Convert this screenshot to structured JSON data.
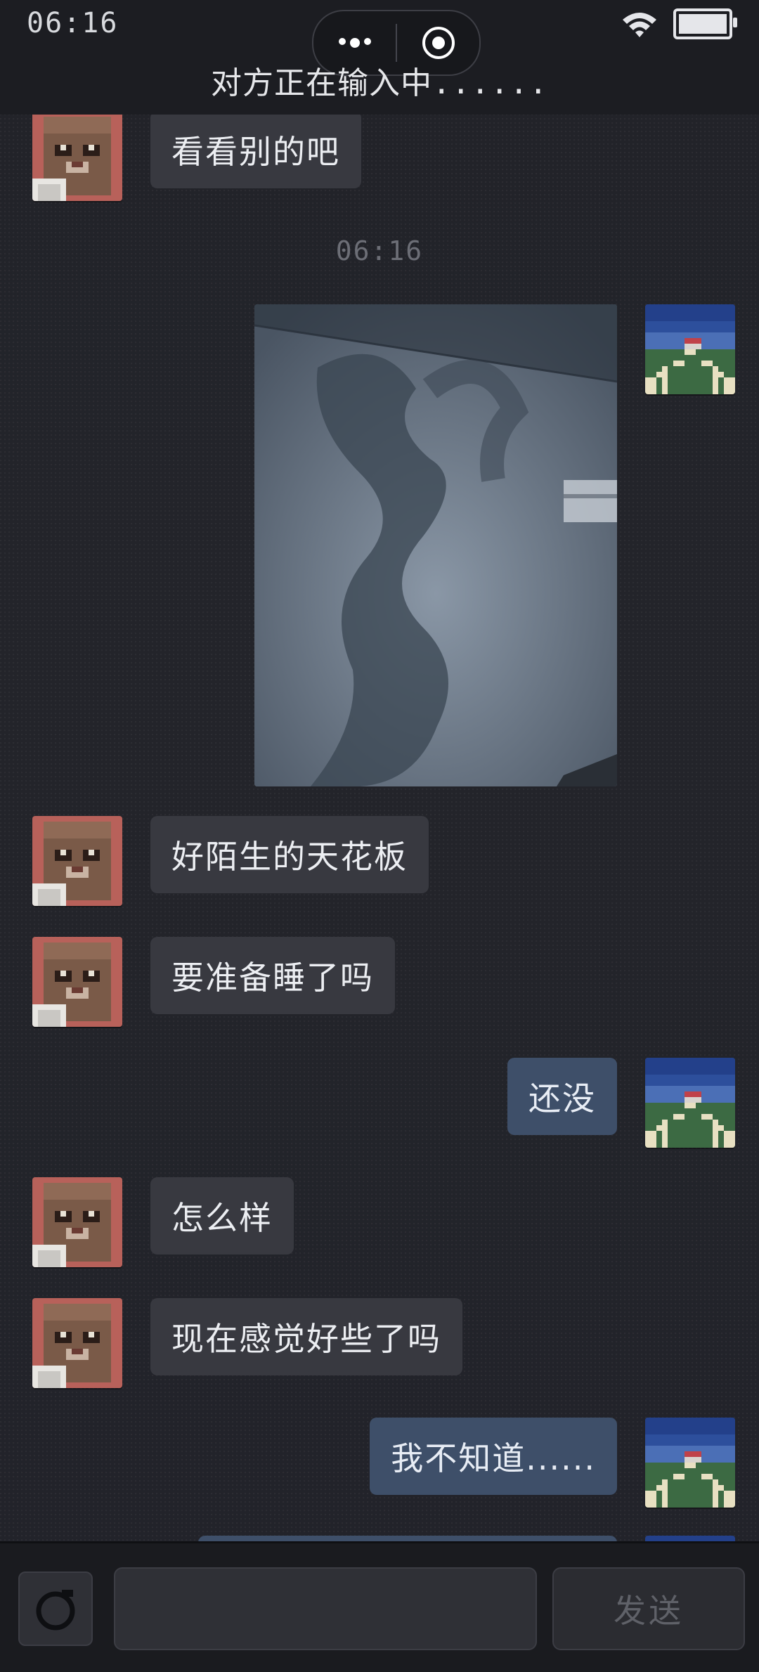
{
  "status_bar": {
    "time": "06:16"
  },
  "header": {
    "title": "对方正在输入中......",
    "capsule_more_icon": "more-dots-icon",
    "capsule_close_icon": "target-circle-icon"
  },
  "messages": [
    {
      "side": "in",
      "type": "text",
      "text": "看看别的吧"
    },
    {
      "type": "timestamp",
      "text": "06:16"
    },
    {
      "side": "out",
      "type": "image",
      "content": "ceiling-photo"
    },
    {
      "side": "in",
      "type": "text",
      "text": "好陌生的天花板"
    },
    {
      "side": "in",
      "type": "text",
      "text": "要准备睡了吗"
    },
    {
      "side": "out",
      "type": "text",
      "text": "还没"
    },
    {
      "side": "in",
      "type": "text",
      "text": "怎么样"
    },
    {
      "side": "in",
      "type": "text",
      "text": "现在感觉好些了吗"
    },
    {
      "side": "out",
      "type": "text",
      "text": "我不知道......"
    }
  ],
  "input_bar": {
    "camera_icon": "camera-icon",
    "input_value": "",
    "send_label": "发送"
  },
  "colors": {
    "background": "#23242a",
    "incoming_bubble": "#383940",
    "outgoing_bubble": "#3e4f69",
    "bar": "#1a1b1f"
  }
}
